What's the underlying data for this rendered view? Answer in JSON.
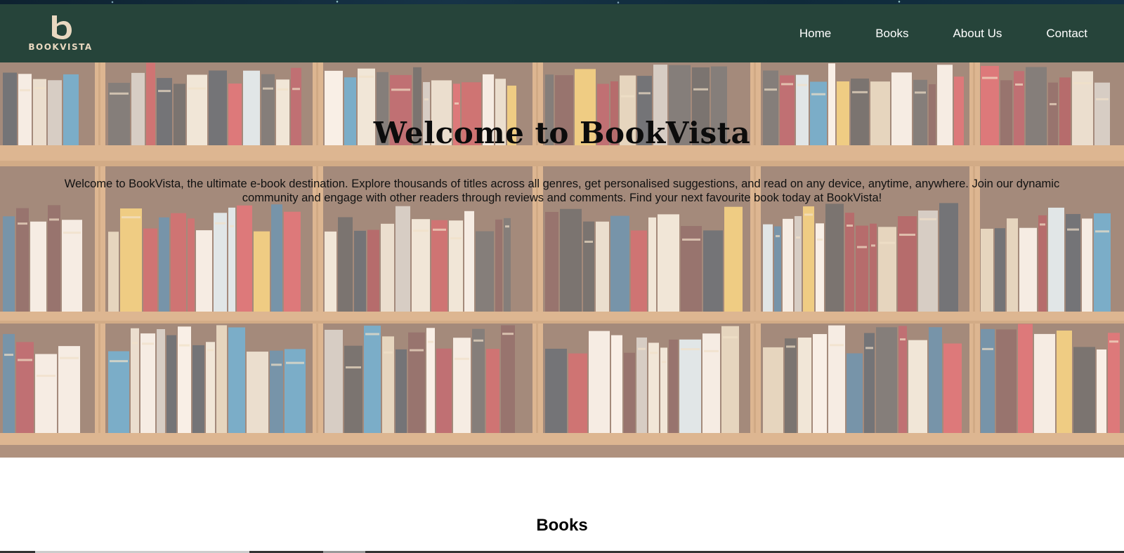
{
  "brand": {
    "logo_letter": "b",
    "logo_text": "BOOKVISTA",
    "logo_icon": "book-b-logo-icon",
    "color_nav": "#26443a",
    "color_logo": "#e9d8c0"
  },
  "nav": {
    "items": [
      {
        "label": "Home"
      },
      {
        "label": "Books"
      },
      {
        "label": "About Us"
      },
      {
        "label": "Contact"
      }
    ]
  },
  "hero": {
    "title": "Welcome to BookVista",
    "text": "Welcome to BookVista, the ultimate e-book destination. Explore thousands of titles across all genres, get personalised suggestions, and read on any device, anytime, anywhere. Join our dynamic community and engage with other readers through reviews and comments. Find your next favourite book today at BookVista!",
    "background": "bookshelf-photo"
  },
  "books_section": {
    "heading": "Books"
  }
}
